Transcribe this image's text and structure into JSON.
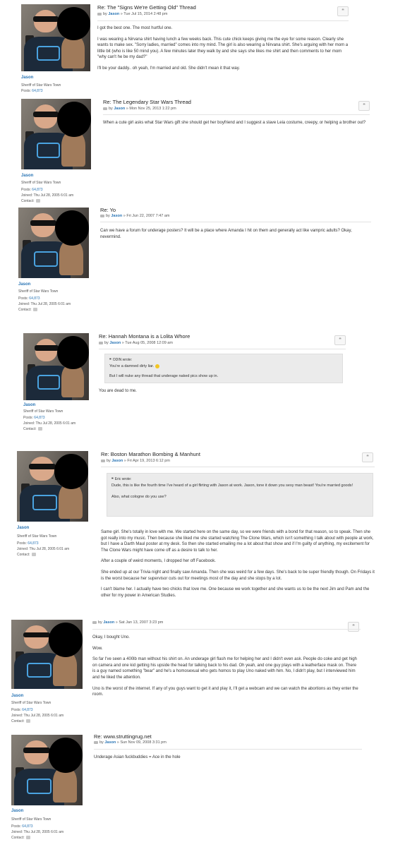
{
  "posts": [
    {
      "title": "Re: The \"Signs We're Getting Old\" Thread",
      "by_prefix": "by",
      "author": "Jason",
      "date": "» Tue Jul 15, 2014 2:48 pm",
      "user": {
        "name": "Jason",
        "rank": "Sheriff of Star Wars Town",
        "posts_label": "Posts:",
        "posts": "64,873"
      },
      "paragraphs": [
        "I got the best one. The most hurtful one.",
        "I was wearing a Nirvana shirt having lunch a few weeks back. This cute chick keeps giving me the eye for some reason. Clearly she wants to make sex. \"Sorry ladies, married\" comes into my mind. The girl is also wearing a Nirvana shirt. She's arguing with her mom a little bit (who is like 50 mind you). A few minutes later they walk by and she says she likes me shirt and then comments to her mom \"why can't he be my dad?\"",
        "I'll be your daddy.. oh yeah, I'm married and old. She didn't mean it that way."
      ]
    },
    {
      "title": "Re: The Legendary Star Wars Thread",
      "by_prefix": "by",
      "author": "Jason",
      "date": "» Mon Nov 25, 2013 1:22 pm",
      "user": {
        "name": "Jason",
        "rank": "Sheriff of Star Wars Town",
        "posts_label": "Posts:",
        "posts": "64,873",
        "joined_label": "Joined:",
        "joined": "Thu Jul 28, 2005 6:01 am",
        "contact_label": "Contact:"
      },
      "paragraphs": [
        "When a cute girl asks what Star Wars gift she should get her boyfriend and I suggest a slave Leia costume, creepy, or helping a brother out?"
      ]
    },
    {
      "title": "Re: Yo",
      "by_prefix": "by",
      "author": "Jason",
      "date": "» Fri Jun 22, 2007 7:47 am",
      "user": {
        "name": "Jason",
        "rank": "Sheriff of Star Wars Town",
        "posts_label": "Posts:",
        "posts": "64,873",
        "joined_label": "Joined:",
        "joined": "Thu Jul 28, 2005 6:01 am",
        "contact_label": "Contact:"
      },
      "paragraphs": [
        "Can we have a forum for underage posters? It will be a place where Amanda I hit on them and generally act like vampric adults? Okay, nevermind."
      ]
    },
    {
      "title": "Re: Hannah Montana is a Lolita Whore",
      "by_prefix": "by",
      "author": "Jason",
      "date": "» Tue Aug 05, 2008 12:09 am",
      "user": {
        "name": "Jason",
        "rank": "Sheriff of Star Wars Town",
        "posts_label": "Posts:",
        "posts": "64,873",
        "joined_label": "Joined:",
        "joined": "Thu Jul 28, 2005 6:01 am",
        "contact_label": "Contact:"
      },
      "quote": {
        "cite": "ODIN wrote:",
        "lines": [
          "You're a damned dirty liar.",
          "But I will nuke any thread that underage naked pics show up in."
        ]
      },
      "paragraphs": [
        "You are dead to me."
      ]
    },
    {
      "title": "Re: Boston Marathon Bombing & Manhunt",
      "by_prefix": "by",
      "author": "Jason",
      "date": "» Fri Apr 19, 2013 6:12 pm",
      "user": {
        "name": "Jason",
        "rank": "Sheriff of Star Wars Town",
        "posts_label": "Posts:",
        "posts": "64,873",
        "joined_label": "Joined:",
        "joined": "Thu Jul 28, 2005 6:01 am",
        "contact_label": "Contact:"
      },
      "quote": {
        "cite": "Eric wrote:",
        "lines": [
          "Dude, this is like the fourth time I've heard of a girl flirting with Jason at work. Jason, tone it down you sexy man beast! You're married goods!",
          "Also, what cologne do you use?"
        ]
      },
      "paragraphs": [
        "Same girl. She's totally in love with me. We started here on the same day, so we were friends with a bond for that reason, so to speak. Then she got really into my music. Then because she liked me she started watching The Clone Wars, which isn't something I talk about with people at work, but I have a Darth Maul poster at my desk. So then she started emailing me a lot about that show and if I'm guilty of anything, my excitement for The Clone Wars might have come off as a desire to talk to her.",
        "After a couple of weird moments, I dropped her off Facebook.",
        "She ended up at our Trivia night and finally saw Amanda. Then she was weird for a few days. She's back to be super friendly though. On Fridays it is the worst because her supervisor cuts out for meetings most of the day and she stops by a lot.",
        "I can't blame her. I actually have two chicks that love me. One because we work together and she wants us to be the next Jim and Pam and the other for my power in American Studies."
      ]
    },
    {
      "title": "",
      "by_prefix": "by",
      "author": "Jason",
      "date": "» Sat Jan 13, 2007 3:23 pm",
      "user": {
        "name": "Jason",
        "rank": "Sheriff of Star Wars Town",
        "posts_label": "Posts:",
        "posts": "64,873",
        "joined_label": "Joined:",
        "joined": "Thu Jul 28, 2005 6:01 am",
        "contact_label": "Contact:"
      },
      "paragraphs": [
        "Okay, I bought Uno.",
        "Wow.",
        "So far I've seen a 400lb man without his shirt on. An underage girl flash me for helping her and I didn't even ask. People do coke and get high on camera and one kid getting his upside the head for talking back to his dad. Oh yeah, and one guy plays with a leatherface mask on. There is a guy named something \"bear\" and he's a homosexual who gets homos to play Uno naked with him. No, I didn't play, but I interviewed him and he liked the attention.",
        "Uno is the worst of the internet. If any of you guys want to get it and play it, I'll get a webcam and we can watch the abortions as they enter the room."
      ]
    },
    {
      "title": "Re: www.struttingrug.net",
      "by_prefix": "by",
      "author": "Jason",
      "date": "» Sun Nov 09, 2008 3:31 pm",
      "user": {
        "name": "Jason",
        "rank": "Sheriff of Star Wars Town",
        "posts_label": "Posts:",
        "posts": "64,873",
        "joined_label": "Joined:",
        "joined": "Thu Jul 28, 2005 6:01 am",
        "contact_label": "Contact:"
      },
      "paragraphs": [
        "Underage Asian fuckbuddies = Ace in the hole"
      ]
    }
  ],
  "quote_button_glyph": "❝",
  "colors": {
    "link": "#2a75b5",
    "quote_bg": "#ebebeb",
    "text": "#333333"
  }
}
